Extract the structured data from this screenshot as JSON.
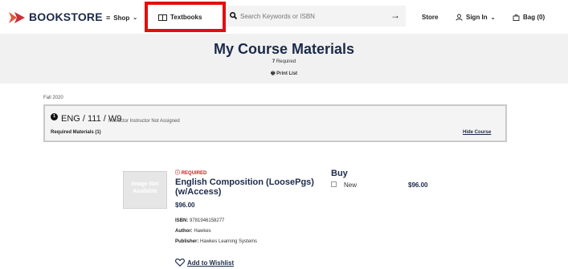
{
  "header": {
    "logo_text": "BOOKSTORE",
    "shop": "Shop",
    "textbooks": "Textbooks",
    "search_placeholder": "Search Keywords or ISBN",
    "store": "Store",
    "sign_in": "Sign In",
    "bag": "Bag (0)"
  },
  "banner": {
    "title": "My Course Materials",
    "required_count": "7",
    "required_label": "Required",
    "print_list": "Print List"
  },
  "term": "Fall 2020",
  "course": {
    "number": "1",
    "code": "ENG / 111 / W9",
    "instructor": "Instructor Instructor Not Assigned",
    "required_materials": "Required Materials (1)",
    "hide_course": "Hide Course"
  },
  "product": {
    "image_text": "Image Not Available",
    "required_tag": "REQUIRED",
    "title": "English Composition (LoosePgs) (w/Access)",
    "price": "$96.00",
    "isbn_label": "ISBN:",
    "isbn": "9781946158277",
    "author_label": "Author:",
    "author": "Hawkes",
    "publisher_label": "Publisher:",
    "publisher": "Hawkes Learning Systems",
    "buy_label": "Buy",
    "new_label": "New",
    "buy_price": "$96.00",
    "wishlist": "Add to Wishlist"
  },
  "colors": {
    "brand_navy": "#1b2a4a",
    "highlight_red": "#e01010",
    "required_red": "#d01c1c"
  }
}
